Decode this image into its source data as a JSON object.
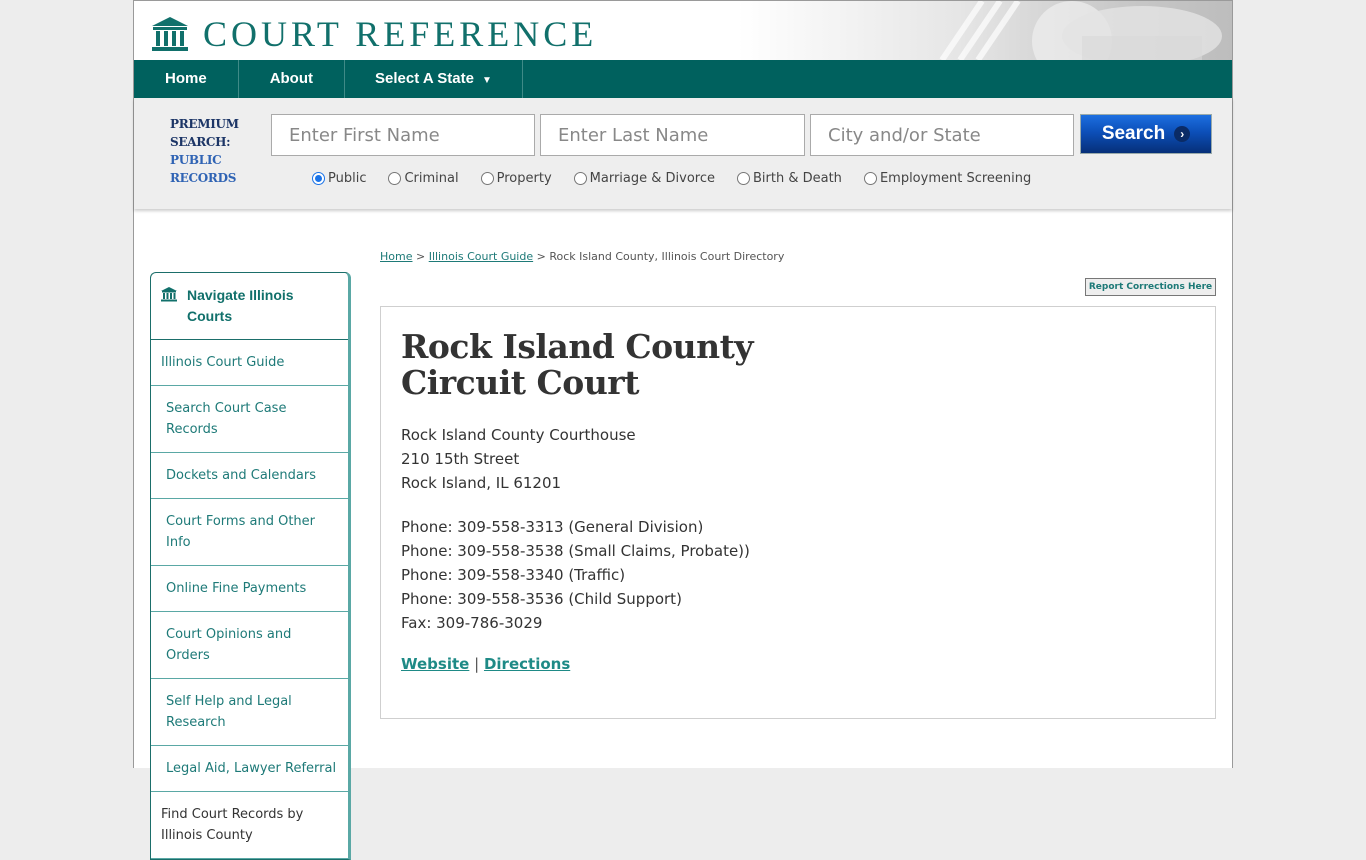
{
  "brand": {
    "name": "COURT REFERENCE",
    "color": "#11706b"
  },
  "nav": {
    "items": [
      {
        "label": "Home"
      },
      {
        "label": "About"
      },
      {
        "label": "Select A State",
        "has_dropdown": true
      }
    ],
    "caret": "▼",
    "bg_color": "#00615e"
  },
  "search": {
    "premium_line1": "PREMIUM",
    "premium_line2": "SEARCH:",
    "premium_line3": "PUBLIC",
    "premium_line4": "RECORDS",
    "first_name": {
      "value": "",
      "placeholder": "Enter First Name"
    },
    "last_name": {
      "value": "",
      "placeholder": "Enter Last Name"
    },
    "location": {
      "value": "",
      "placeholder": "City and/or State"
    },
    "button_label": "Search",
    "button_arrow": "›",
    "radios": [
      {
        "label": "Public",
        "checked": true
      },
      {
        "label": "Criminal",
        "checked": false
      },
      {
        "label": "Property",
        "checked": false
      },
      {
        "label": "Marriage & Divorce",
        "checked": false
      },
      {
        "label": "Birth & Death",
        "checked": false
      },
      {
        "label": "Employment Screening",
        "checked": false
      }
    ]
  },
  "sidebar": {
    "title": "Navigate Illinois Courts",
    "items": [
      {
        "label": "Illinois Court Guide"
      },
      {
        "label": "Search Court Case Records"
      },
      {
        "label": "Dockets and Calendars"
      },
      {
        "label": "Court Forms and Other Info"
      },
      {
        "label": "Online Fine Payments"
      },
      {
        "label": "Court Opinions and Orders"
      },
      {
        "label": "Self Help and Legal Research"
      },
      {
        "label": "Legal Aid, Lawyer Referral"
      },
      {
        "label": "Find Court Records by Illinois County"
      }
    ]
  },
  "breadcrumb": {
    "home": "Home",
    "sep": ">",
    "guide": "Illinois Court Guide",
    "current": "Rock Island County, Illinois Court Directory"
  },
  "report_button": "Report Corrections Here",
  "court": {
    "title_line1": "Rock Island County",
    "title_line2": "Circuit Court",
    "address": [
      "Rock Island County Courthouse",
      "210 15th Street",
      "Rock Island, IL 61201"
    ],
    "contacts": [
      "Phone: 309-558-3313 (General Division)",
      "Phone: 309-558-3538 (Small Claims, Probate))",
      "Phone: 309-558-3340 (Traffic)",
      "Phone: 309-558-3536 (Child Support)",
      "Fax: 309-786-3029"
    ],
    "website_label": "Website",
    "link_sep": "|",
    "directions_label": "Directions"
  }
}
